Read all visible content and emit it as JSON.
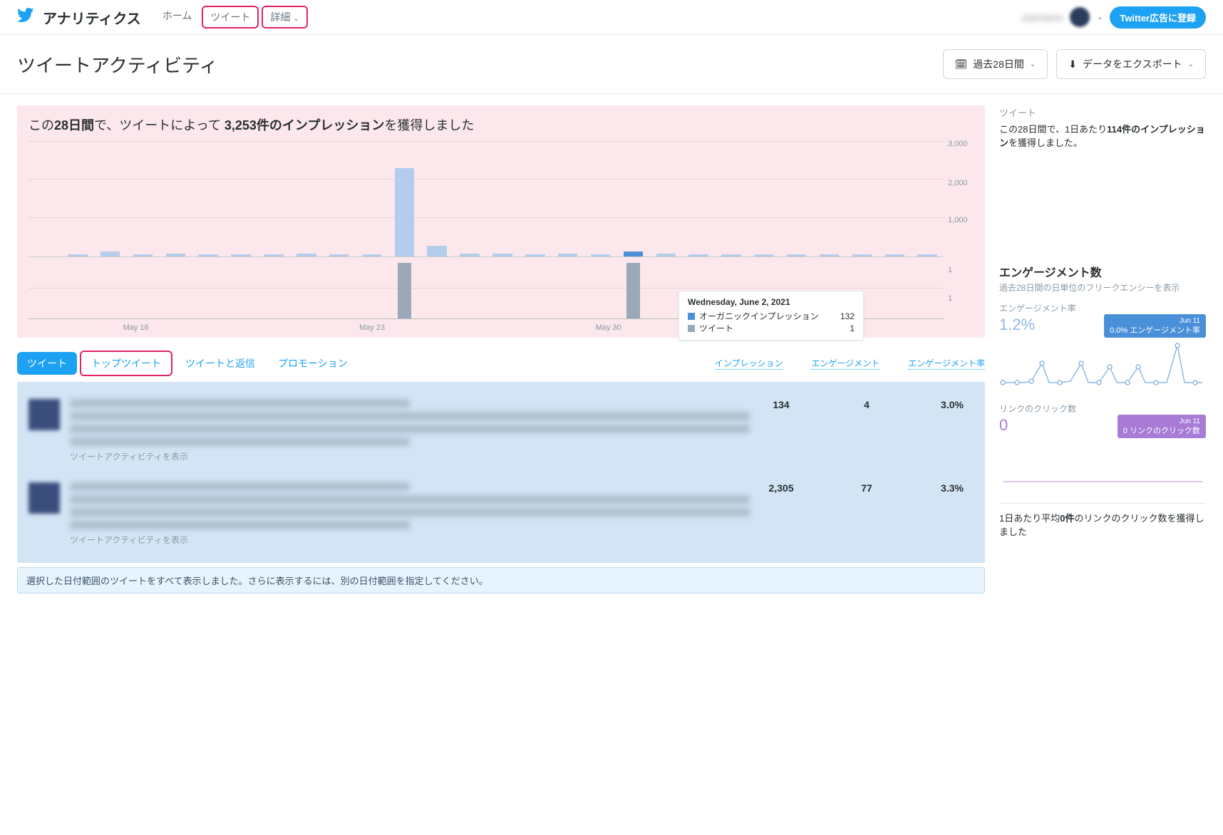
{
  "nav": {
    "brand": "アナリティクス",
    "links": [
      "ホーム",
      "ツイート",
      "詳細"
    ],
    "register": "Twitter広告に登録",
    "user_blur": "username"
  },
  "header": {
    "title": "ツイートアクティビティ",
    "date_range_btn": "過去28日間",
    "export_btn": "データをエクスポート"
  },
  "impressions": {
    "headline_pre": "この",
    "headline_days": "28日間",
    "headline_mid": "で、ツイートによって",
    "headline_count": "3,253件のインプレッション",
    "headline_post": "を獲得しました"
  },
  "chart_data": {
    "type": "bar",
    "xticks": [
      "May 16",
      "May 23",
      "May 30"
    ],
    "yticks_upper": [
      "1,000",
      "2,000",
      "3,000"
    ],
    "yticks_lower": [
      "1",
      "1"
    ],
    "ylim_upper": [
      0,
      3000
    ],
    "series_upper": {
      "name": "オーガニックインプレッション",
      "color": "#b4cdec",
      "values": [
        0,
        60,
        120,
        60,
        70,
        60,
        60,
        60,
        70,
        60,
        60,
        2300,
        280,
        80,
        70,
        60,
        70,
        60,
        132,
        80,
        60,
        60,
        60,
        60,
        60,
        60,
        60,
        60
      ]
    },
    "series_upper_highlight_index": 18,
    "series_lower": {
      "name": "ツイート",
      "color": "#9aa8b8",
      "values": [
        0,
        0,
        0,
        0,
        0,
        0,
        0,
        0,
        0,
        0,
        0,
        1,
        0,
        0,
        0,
        0,
        0,
        0,
        1,
        0,
        0,
        0,
        0,
        0,
        0,
        0,
        0,
        0
      ]
    },
    "tooltip": {
      "date": "Wednesday, June 2, 2021",
      "rows": [
        {
          "color": "#4a90d9",
          "label": "オーガニックインプレッション",
          "value": "132"
        },
        {
          "color": "#9aa8b8",
          "label": "ツイート",
          "value": "1"
        }
      ]
    }
  },
  "tabs": {
    "items": [
      "ツイート",
      "トップツイート",
      "ツイートと返信",
      "プロモーション"
    ],
    "col_headers": [
      "インプレッション",
      "エンゲージメント",
      "エンゲージメント率"
    ]
  },
  "tweets": [
    {
      "impressions": "134",
      "engagements": "4",
      "rate": "3.0%",
      "link_text": "ツイートアクティビティを表示"
    },
    {
      "impressions": "2,305",
      "engagements": "77",
      "rate": "3.3%",
      "link_text": "ツイートアクティビティを表示"
    }
  ],
  "notice": "選択した日付範囲のツイートをすべて表示しました。さらに表示するには、別の日付範囲を指定してください。",
  "sidebar": {
    "tweet_summary": {
      "heading": "ツイート",
      "text_pre": "この28日間で、1日あたり",
      "text_bold": "114件のインプレッション",
      "text_post": "を獲得しました。"
    },
    "engagement": {
      "title": "エンゲージメント数",
      "sub": "過去28日間の日単位のフリークエンシーを表示"
    },
    "sparks": [
      {
        "label": "エンゲージメント率",
        "value": "1.2%",
        "badge_date": "Jun 11",
        "badge_text": "0.0% エンゲージメント率",
        "color": "blue"
      },
      {
        "label": "リンクのクリック数",
        "value": "0",
        "badge_date": "Jun 11",
        "badge_text": "0 リンクのクリック数",
        "color": "purple"
      }
    ],
    "bottom_note_pre": "1日あたり平均",
    "bottom_note_bold": "0件",
    "bottom_note_post": "のリンクのクリック数を獲得しました"
  }
}
